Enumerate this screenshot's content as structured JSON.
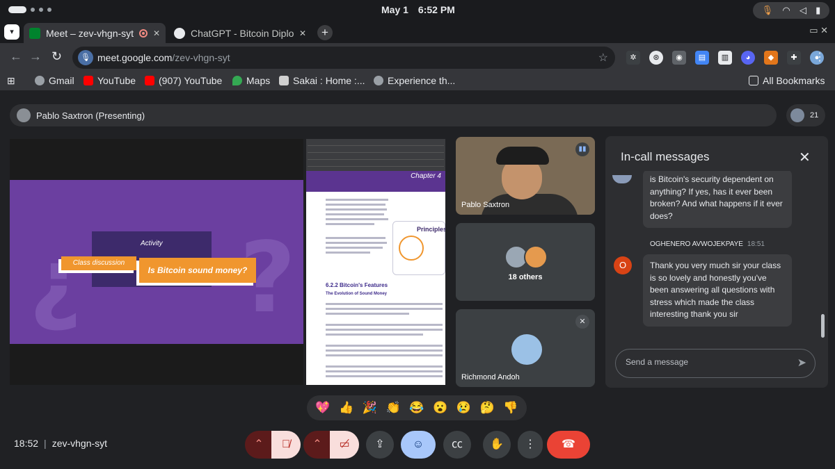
{
  "system": {
    "date": "May 1",
    "time": "6:52 PM"
  },
  "browser": {
    "tabs": [
      {
        "title": "Meet – zev-vhgn-syt",
        "active": true
      },
      {
        "title": "ChatGPT - Bitcoin Diploma",
        "active": false
      }
    ],
    "new_tab_label": "+",
    "url_host": "meet.google.com",
    "url_path": "/zev-vhgn-syt",
    "bookmarks": [
      {
        "label": "Gmail",
        "icon": "globe-icon",
        "color": "#9aa0a6"
      },
      {
        "label": "YouTube",
        "icon": "youtube-icon",
        "color": "#ff0000"
      },
      {
        "label": "(907) YouTube",
        "icon": "youtube-icon",
        "color": "#ff0000"
      },
      {
        "label": "Maps",
        "icon": "maps-icon",
        "color": "#34a853"
      },
      {
        "label": "Sakai : Home :...",
        "icon": "sakai-icon",
        "color": "#d0d0d0"
      },
      {
        "label": "Experience th...",
        "icon": "globe-icon",
        "color": "#9aa0a6"
      }
    ],
    "all_bookmarks": "All Bookmarks"
  },
  "meet": {
    "presenting_label": "Pablo Saxtron (Presenting)",
    "participant_count": "21",
    "slide": {
      "activity": "Activity",
      "tag_left": "Class discussion",
      "tag_right": "Is Bitcoin sound money?"
    },
    "document": {
      "chapter": "Chapter 4",
      "principles": "Principles",
      "heading": "6.2.2 Bitcoin's Features",
      "subheading": "The Evolution of Sound Money"
    },
    "tiles": [
      {
        "name": "Pablo Saxtron",
        "state": "speaking"
      },
      {
        "name": "18 others",
        "state": "group"
      },
      {
        "name": "Richmond Andoh",
        "state": "muted"
      }
    ],
    "chat": {
      "title": "In-call messages",
      "messages": [
        {
          "sender": "",
          "time": "",
          "text": "is Bitcoin's security dependent on anything? If yes, has it ever been broken? And what happens if it ever does?"
        },
        {
          "sender": "OGHENERO AVWOJEKPAYE",
          "time": "18:51",
          "avatar_letter": "O",
          "text": "Thank you very much sir your class is so lovely and honestly you've been answering all questions with stress which made the class interesting thank you sir"
        }
      ],
      "input_placeholder": "Send a message"
    },
    "reactions": [
      "💖",
      "👍",
      "🎉",
      "👏",
      "😂",
      "😮",
      "😢",
      "🤔",
      "👎"
    ],
    "bottom": {
      "time": "18:52",
      "meeting_code": "zev-vhgn-syt"
    }
  }
}
